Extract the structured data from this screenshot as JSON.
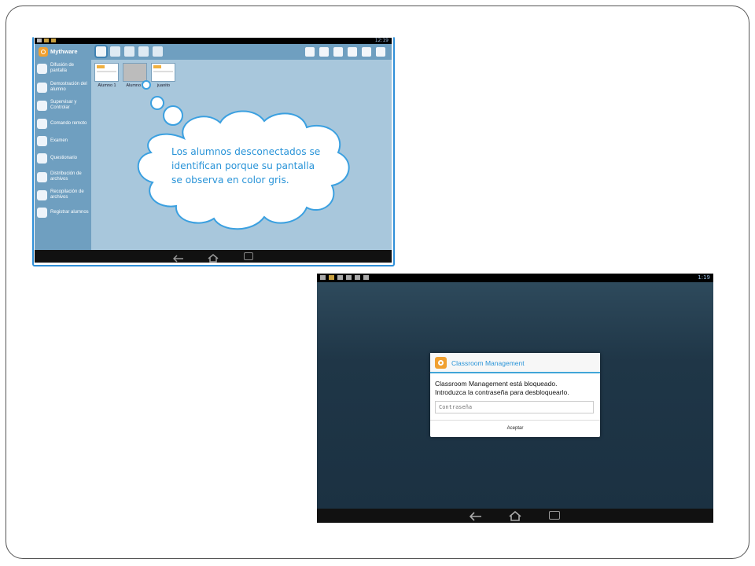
{
  "screenshot1": {
    "status_bar": {
      "time": "12:19"
    },
    "app": {
      "name": "Mythware"
    },
    "view_icons": [
      "thumbnail-view-icon",
      "list-view-icon",
      "group-view-icon",
      "save-icon",
      "refresh-icon"
    ],
    "tool_icons": [
      "broadcast-icon",
      "monitor-icon",
      "chat-icon",
      "message-icon",
      "fullscreen-icon",
      "settings-icon"
    ],
    "sidebar": {
      "items": [
        {
          "label": "Difusión de pantalla",
          "icon": "screen-broadcast-icon"
        },
        {
          "label": "Demostración del alumno",
          "icon": "student-demo-icon"
        },
        {
          "label": "Supervisar y Controlar",
          "icon": "monitor-control-icon"
        },
        {
          "label": "Comando remoto",
          "icon": "remote-command-icon"
        },
        {
          "label": "Examen",
          "icon": "exam-icon"
        },
        {
          "label": "Questionario",
          "icon": "questionnaire-icon"
        },
        {
          "label": "Distribución de archivos",
          "icon": "file-distribution-icon"
        },
        {
          "label": "Recopilación de archivos",
          "icon": "file-collection-icon"
        },
        {
          "label": "Registrar alumnos",
          "icon": "register-students-icon"
        }
      ]
    },
    "students": [
      {
        "name": "Alumno 1",
        "status": "online"
      },
      {
        "name": "Alumno 2",
        "status": "offline"
      },
      {
        "name": "juanito",
        "status": "online"
      }
    ],
    "callout": {
      "line1": "Los alumnos desconectados se",
      "line2": "identifican porque su pantalla",
      "line3": "se observa en color gris."
    },
    "colors": {
      "accent": "#6f9fc0",
      "callout_text": "#2a94d8",
      "callout_border": "#3ba0e0"
    }
  },
  "screenshot2": {
    "status_bar": {
      "time": "1:19"
    },
    "dialog": {
      "title": "Classroom Management",
      "message_line1": "Classroom Management está bloqueado.",
      "message_line2": "Introduzca la contraseña para desbloquearlo.",
      "password_placeholder": "Contraseña",
      "accept_label": "Aceptar"
    },
    "colors": {
      "background": "#1d3343",
      "dialog_accent": "#41a6d8"
    }
  },
  "nav_icons": [
    "back-icon",
    "home-icon",
    "recent-apps-icon"
  ]
}
